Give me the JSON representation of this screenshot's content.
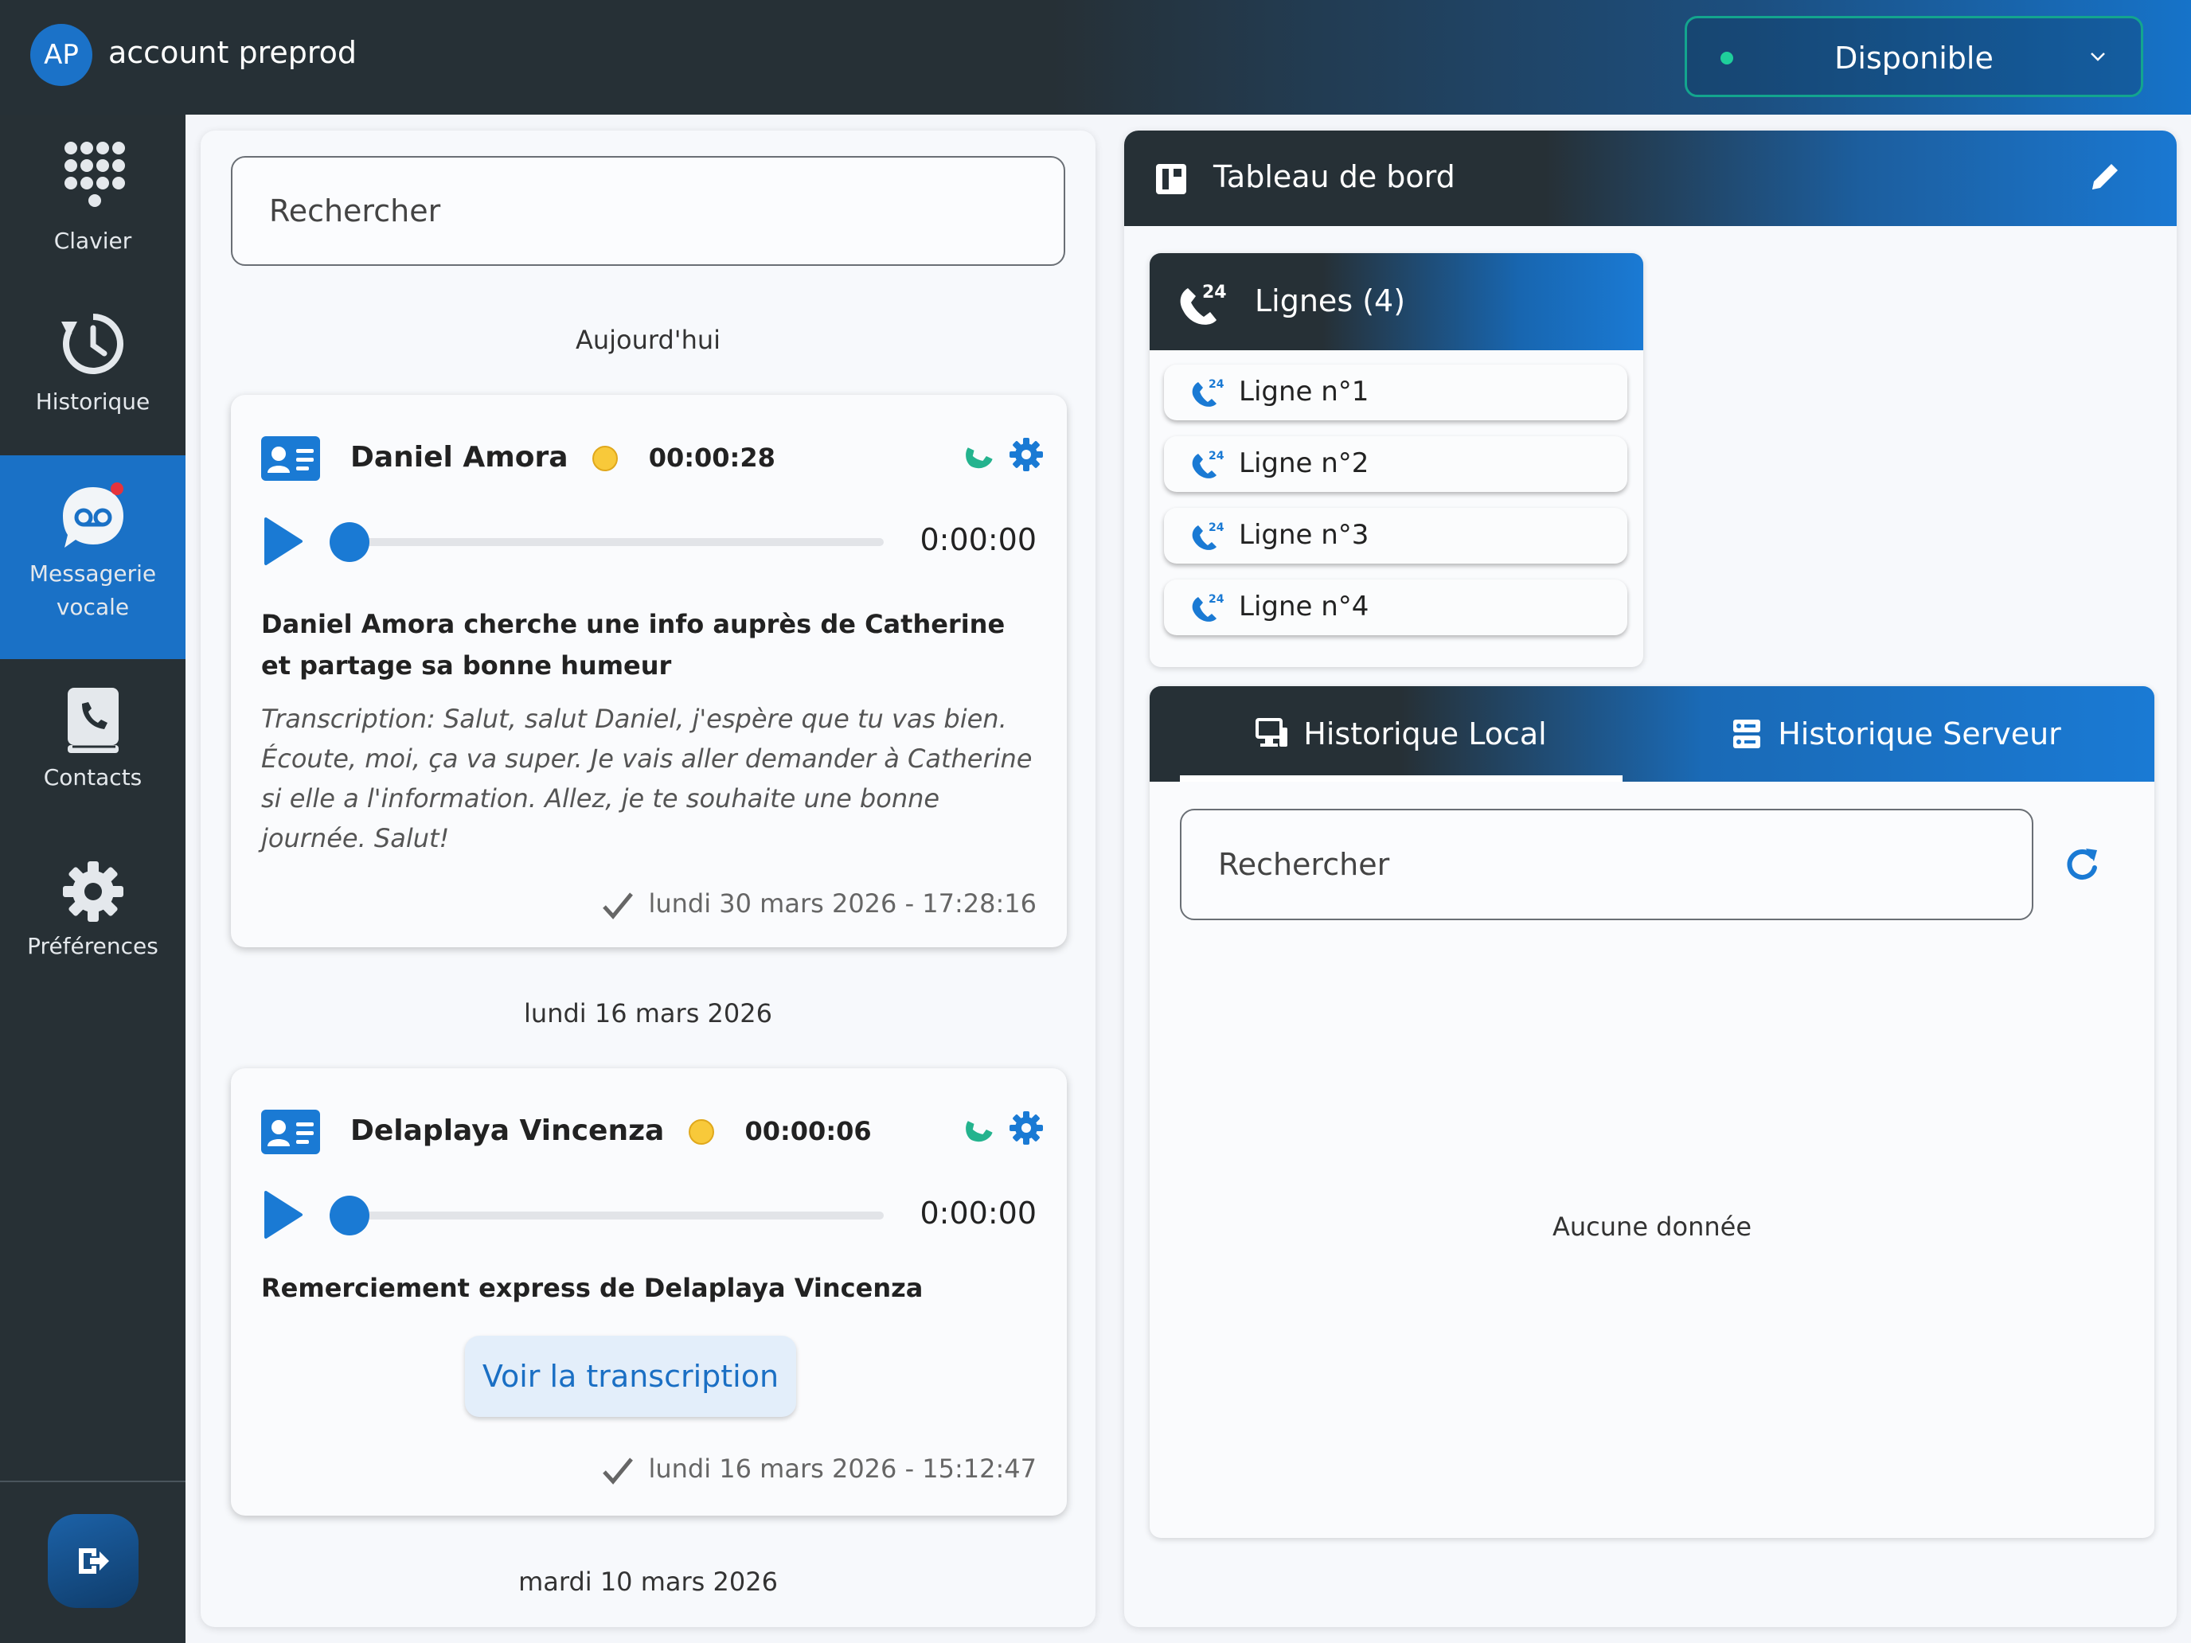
{
  "account": {
    "initials": "AP",
    "name": "account preprod"
  },
  "status": {
    "label": "Disponible",
    "dot_color": "#1fcf9b"
  },
  "sidebar": {
    "items": [
      {
        "label": "Clavier",
        "icon": "dialpad-icon"
      },
      {
        "label": "Historique",
        "icon": "history-icon"
      },
      {
        "label": "Messagerie vocale",
        "icon": "voicemail-icon",
        "active": true
      },
      {
        "label": "Contacts",
        "icon": "contacts-book-icon"
      },
      {
        "label": "Préférences",
        "icon": "gear-icon"
      }
    ],
    "logout_icon": "logout-icon"
  },
  "voicemail": {
    "search_placeholder": "Rechercher",
    "groups": [
      {
        "date": "Aujourd'hui",
        "items": [
          {
            "name": "Daniel Amora",
            "duration": "00:00:28",
            "time": "0:00:00",
            "title": "Daniel Amora cherche une info auprès de Catherine et partage sa bonne humeur",
            "transcript": "Transcription: Salut, salut Daniel, j'espère que tu vas bien. Écoute, moi, ça va super. Je vais aller demander à Catherine si elle a l'information. Allez, je te souhaite une bonne journée. Salut!",
            "date": "lundi 30 mars 2026 - 17:28:16"
          }
        ]
      },
      {
        "date": "lundi 16 mars 2026",
        "items": [
          {
            "name": "Delaplaya Vincenza",
            "duration": "00:00:06",
            "time": "0:00:00",
            "title": "Remerciement express de Delaplaya Vincenza",
            "button": "Voir la transcription",
            "date": "lundi 16 mars 2026 - 15:12:47"
          }
        ]
      },
      {
        "date": "mardi 10 mars 2026",
        "items": []
      }
    ]
  },
  "dashboard": {
    "title": "Tableau de bord",
    "lines": {
      "title": "Lignes (4)",
      "items": [
        "Ligne n°1",
        "Ligne n°2",
        "Ligne n°3",
        "Ligne n°4"
      ]
    },
    "history": {
      "tabs": [
        "Historique Local",
        "Historique Serveur"
      ],
      "active_tab": "Historique Local",
      "search_placeholder": "Rechercher",
      "empty": "Aucune donnée"
    }
  },
  "colors": {
    "accent": "#1a7ad4",
    "sidebar_bg": "#273035",
    "call_green": "#24b38e"
  }
}
